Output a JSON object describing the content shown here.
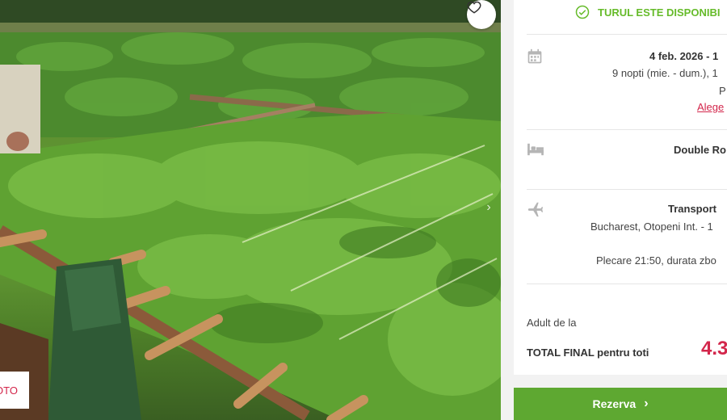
{
  "photo": {
    "foto_label": "OTO",
    "favorite_icon": "heart-icon",
    "next_icon": "chevron-right-icon"
  },
  "availability": {
    "text": "TURUL ESTE DISPONIBI",
    "icon": "check-circle-icon",
    "color": "#66bb2a"
  },
  "dates": {
    "icon": "calendar-icon",
    "range": "4 feb. 2026 - 1",
    "nights": "9 nopti (mie. - dum.), 1",
    "extra": "P",
    "choose_link": "Alege"
  },
  "room": {
    "icon": "bed-icon",
    "type": "Double Ro"
  },
  "transport": {
    "icon": "plane-icon",
    "title": "Transport",
    "route": "Bucharest, Otopeni Int. - 1",
    "departure": "Plecare 21:50, durata zbo"
  },
  "pricing": {
    "adult_label": "Adult de la",
    "total_label": "TOTAL FINAL pentru toti",
    "total_value": "4.3",
    "accent": "#d3264b"
  },
  "book_button": {
    "label": "Rezerva",
    "icon": "chevron-right-icon",
    "color": "#5ea831"
  }
}
